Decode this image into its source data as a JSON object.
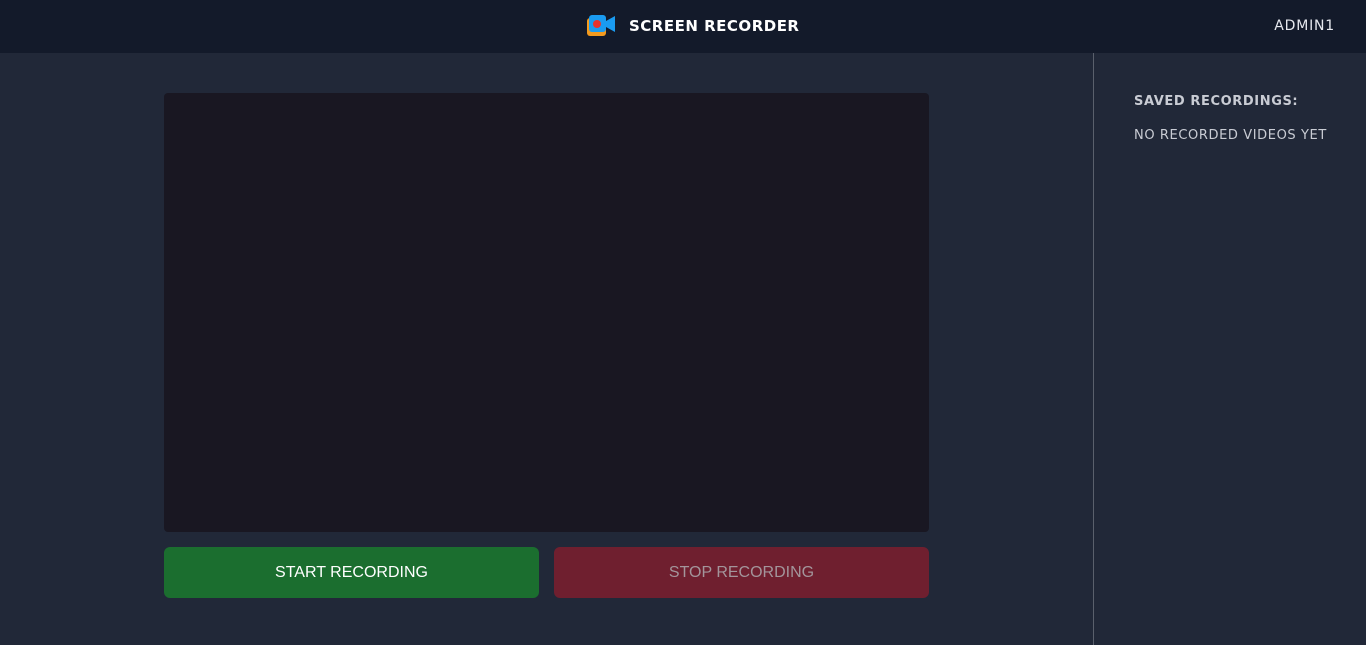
{
  "header": {
    "logo_icon": "video-camera-icon",
    "title": "SCREEN RECORDER",
    "user": "ADMIN1"
  },
  "recorder": {
    "start_label": "START RECORDING",
    "stop_label": "STOP RECORDING"
  },
  "sidebar": {
    "title": "SAVED RECORDINGS:",
    "empty_message": "NO RECORDED VIDEOS YET"
  },
  "colors": {
    "background": "#212838",
    "header": "#131a2a",
    "preview": "#191722",
    "start_button": "#1b6e2f",
    "stop_button": "#6f1f2f",
    "logo_orange": "#f39a1e",
    "logo_red": "#e8322d",
    "logo_blue": "#1a9bf0"
  }
}
